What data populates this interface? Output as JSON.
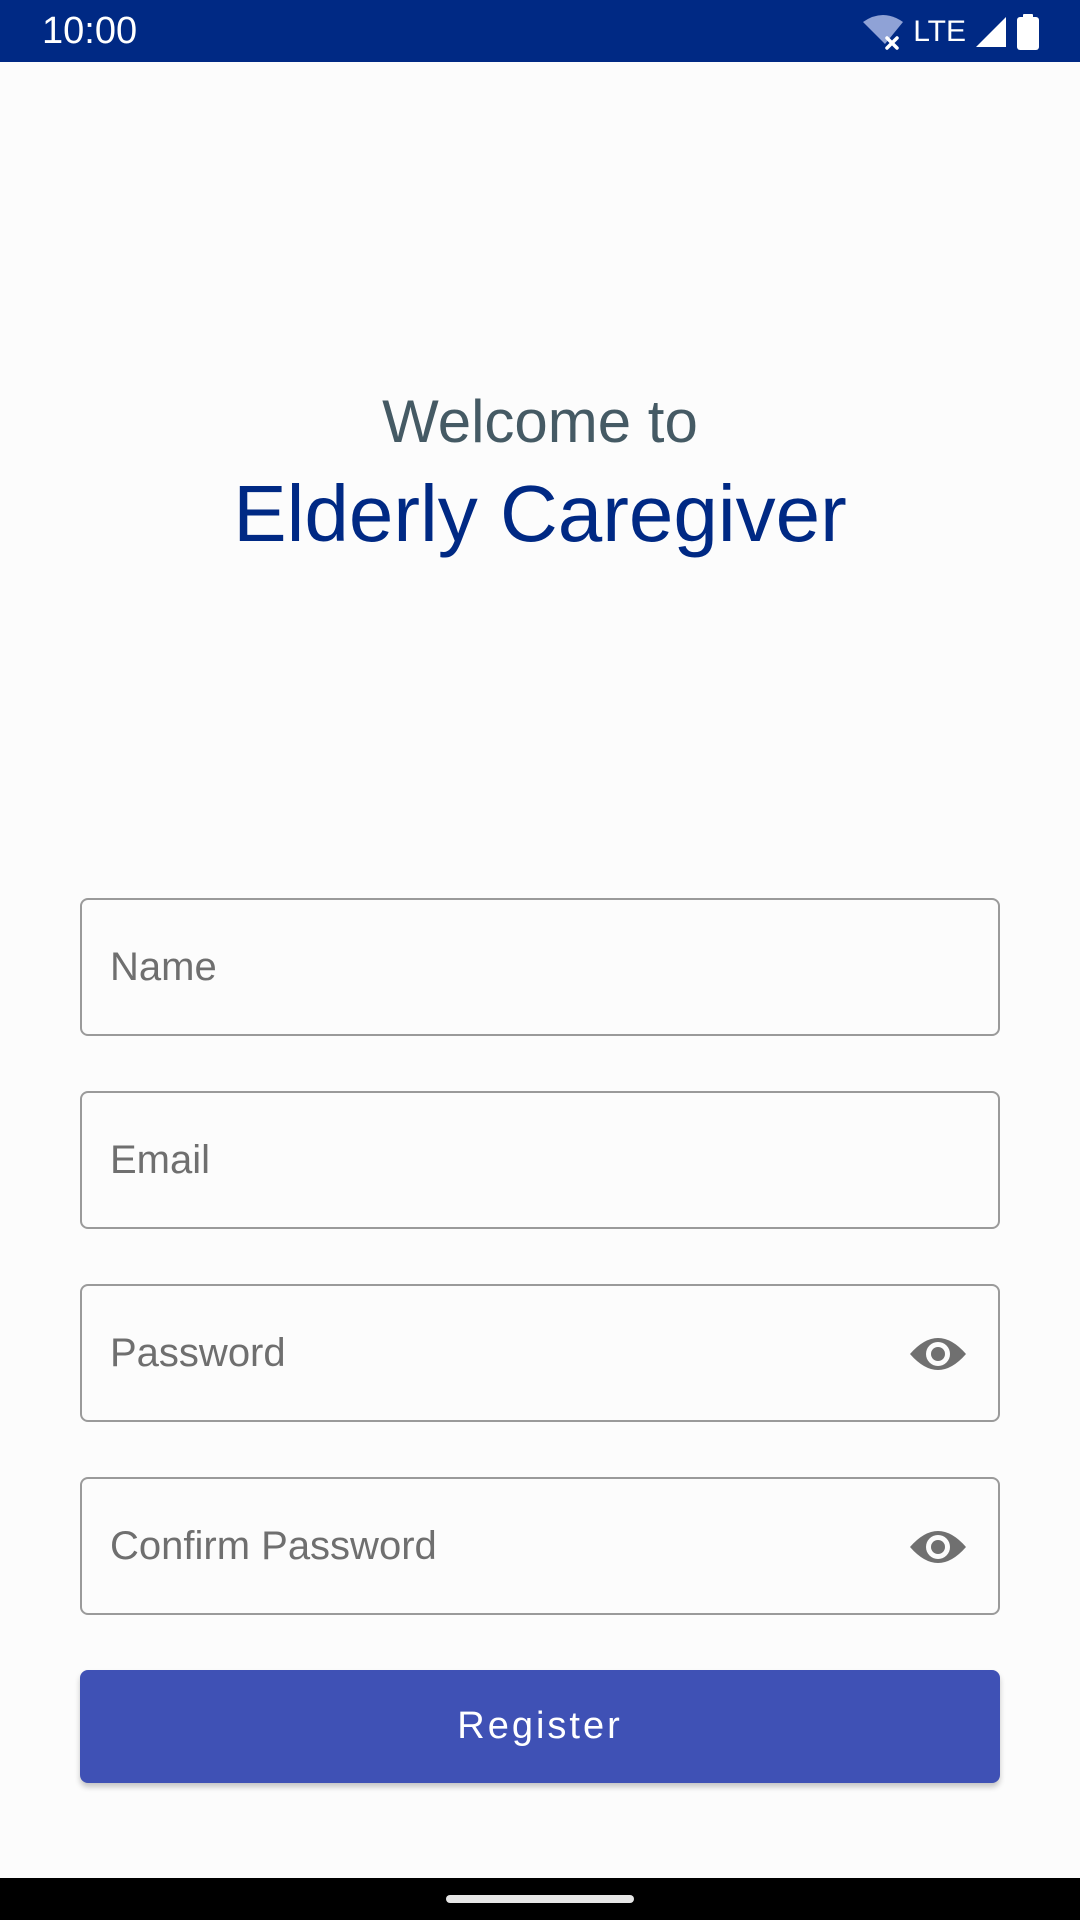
{
  "status_bar": {
    "time": "10:00",
    "network": "LTE",
    "icons": [
      "wifi-off-icon",
      "signal-icon",
      "battery-icon"
    ],
    "background": "#002984"
  },
  "header": {
    "welcome": "Welcome to",
    "app_name": "Elderly Caregiver"
  },
  "form": {
    "name_placeholder": "Name",
    "email_placeholder": "Email",
    "password_placeholder": "Password",
    "confirm_placeholder": "Confirm Password",
    "register_label": "Register"
  },
  "colors": {
    "primary": "#3f51b5",
    "primary_dark": "#002984",
    "welcome_text": "#455a64"
  }
}
